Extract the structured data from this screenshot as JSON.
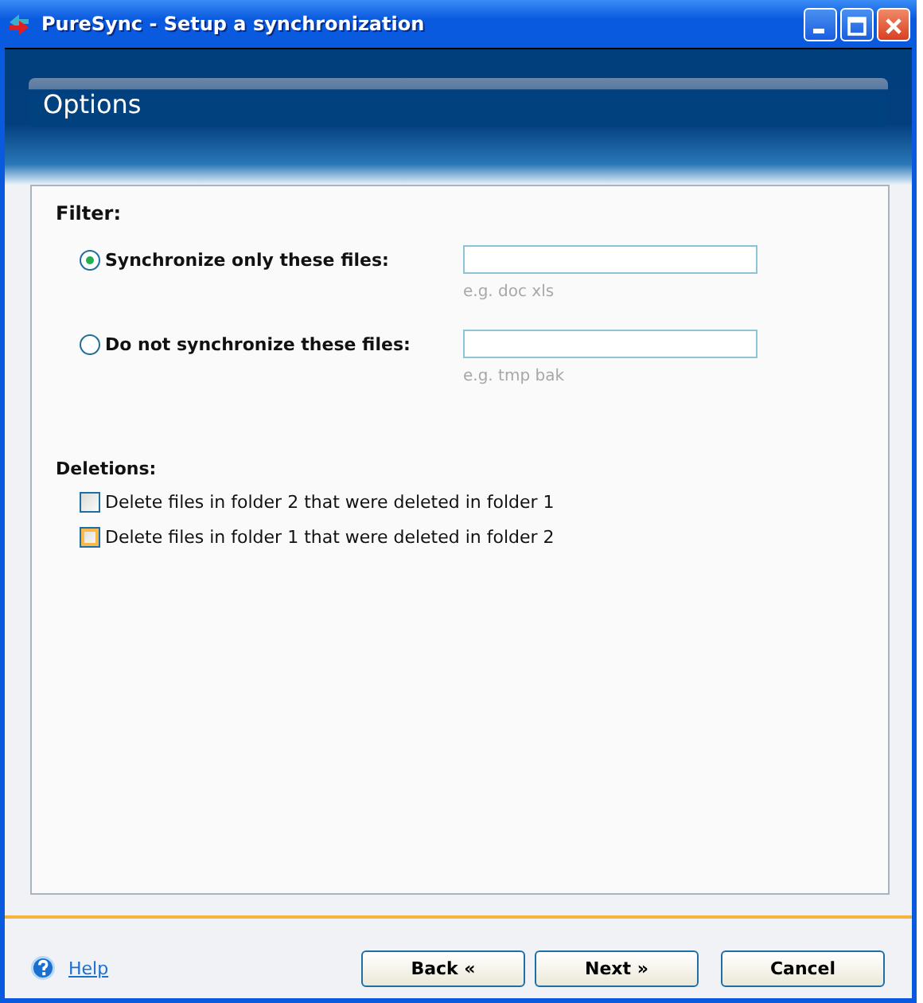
{
  "window": {
    "title": "PureSync - Setup a synchronization"
  },
  "header": {
    "title": "Options"
  },
  "filter": {
    "heading": "Filter:",
    "options": [
      {
        "label": "Synchronize only these files:",
        "selected": true,
        "hint": "e.g. doc xls"
      },
      {
        "label": "Do not synchronize these files:",
        "selected": false,
        "hint": "e.g. tmp bak"
      }
    ]
  },
  "deletions": {
    "heading": "Deletions:",
    "options": [
      {
        "label": "Delete files in folder 2 that were deleted in folder 1",
        "checked": false,
        "hovered": false
      },
      {
        "label": "Delete files in folder 1 that were deleted in folder 2",
        "checked": false,
        "hovered": true
      }
    ]
  },
  "footer": {
    "help": "Help",
    "buttons": [
      "Back «",
      "Next »",
      "Cancel"
    ]
  }
}
